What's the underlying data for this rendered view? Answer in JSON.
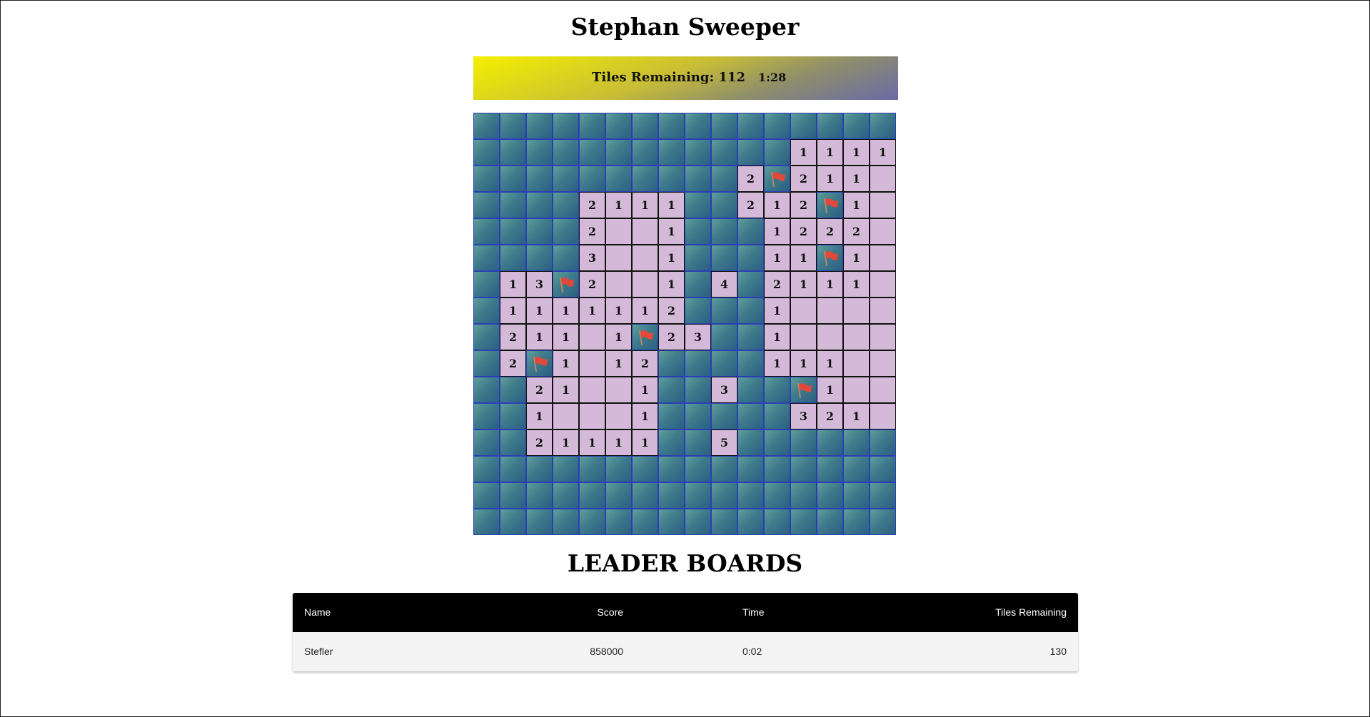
{
  "title": "Stephan Sweeper",
  "status": {
    "tiles_label": "Tiles Remaining: 112",
    "timer": "1:28"
  },
  "board": {
    "rows": [
      "################",
      "############1111",
      "##########2F211.",
      "####2111##212F1.",
      "####2..1###1222.",
      "####3..1###11F1.",
      "#13F2..1#4#2111.",
      "#1111112###1....",
      "#211.1F23##1....",
      "#2F1.12####111..",
      "##21..1##3##F1..",
      "##1...1#####321",
      "##21111##5######",
      "################",
      "################",
      "################"
    ]
  },
  "leaderboard": {
    "title": "LEADER BOARDS",
    "headers": {
      "name": "Name",
      "score": "Score",
      "time": "Time",
      "tiles": "Tiles Remaining"
    },
    "rows": [
      {
        "name": "Stefler",
        "score": "858000",
        "time": "0:02",
        "tiles": "130"
      }
    ]
  },
  "icons": {
    "flag": "flag-icon"
  },
  "colors": {
    "open_tile": "#d4bad8",
    "hidden_tile": "#3e7a8b",
    "flag": "#e0493a"
  }
}
